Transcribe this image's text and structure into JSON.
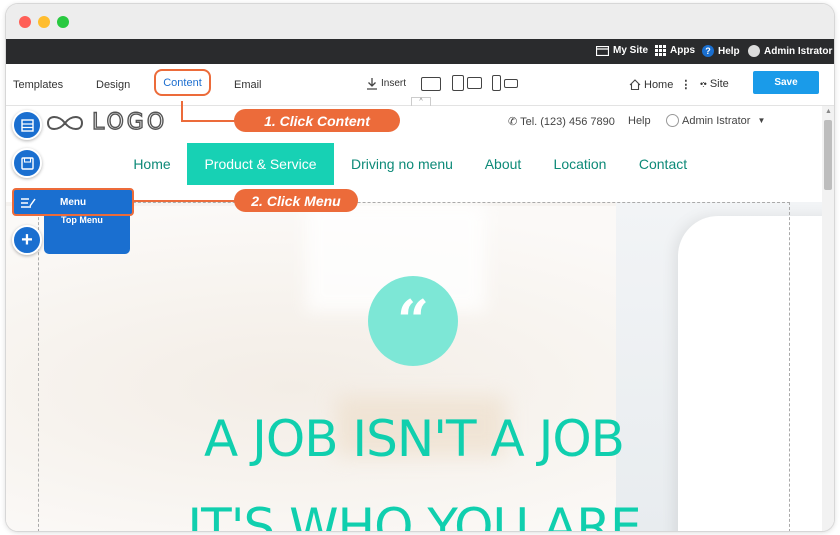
{
  "colors": {
    "accent": "#17d1b4",
    "nav_text": "#0d8a78",
    "callout": "#ec6b3a",
    "editor_blue": "#1a6fd0",
    "save_blue": "#1a9be9",
    "admin_bar": "#2a2b2d"
  },
  "window": {
    "traffic_lights": [
      "#ff5f57",
      "#ffbd2e",
      "#28c940"
    ]
  },
  "admin_bar": {
    "my_site": "My Site",
    "apps": "Apps",
    "help": "Help",
    "user": "Admin Istrator"
  },
  "toolbar": {
    "tabs": [
      "Templates",
      "Design",
      "Content",
      "Email"
    ],
    "insert": "Insert",
    "home": "Home",
    "site": "Site",
    "save": "Save"
  },
  "site": {
    "logo_text": "LOGO",
    "phone": "Tel. (123) 456 7890",
    "help": "Help",
    "user": "Admin Istrator",
    "nav": [
      "Home",
      "Product & Service",
      "Driving no menu",
      "About",
      "Location",
      "Contact"
    ],
    "active_nav": "Product & Service",
    "quote_mark": "“",
    "headline_1": "A JOB ISN'T A JOB",
    "headline_2": "IT'S WHO YOU ARE"
  },
  "editor_panel": {
    "menu_label": "Menu",
    "submenu_item": "Top Menu"
  },
  "callouts": {
    "step1": "1. Click Content",
    "step2": "2. Click Menu"
  }
}
